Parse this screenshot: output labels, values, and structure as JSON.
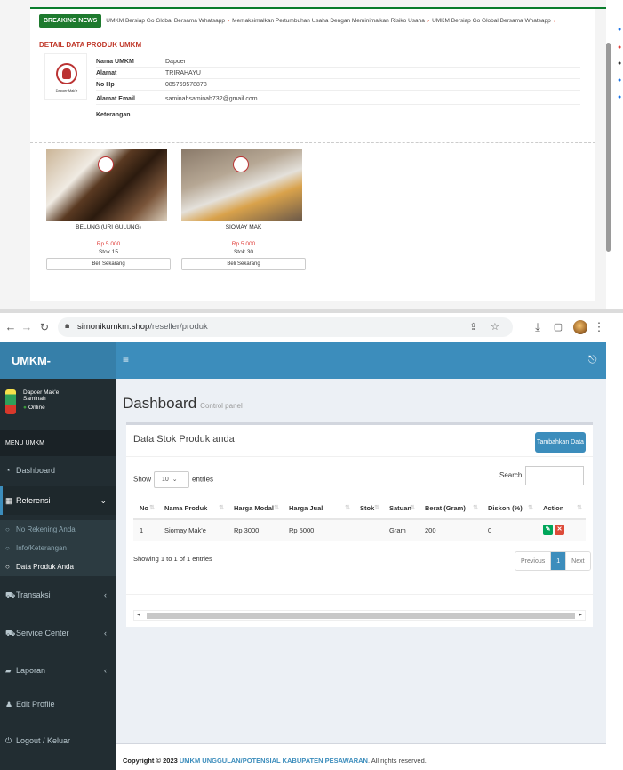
{
  "top_page": {
    "breaking_label": "BREAKING NEWS",
    "ticker": [
      "UMKM Bersiap Go Global Bersama Whatsapp",
      "Memaksimalkan Pertumbuhan Usaha Dengan Meminimalkan Risiko Usaha",
      "UMKM Bersiap Go Global Bersama Whatsapp"
    ],
    "detail_title": "DETAIL DATA PRODUK UMKM",
    "details": [
      {
        "key": "Nama UMKM",
        "value": "Dapoer"
      },
      {
        "key": "Alamat",
        "value": "TRIRAHAYU"
      },
      {
        "key": "No Hp",
        "value": "085769578878"
      },
      {
        "key": "Alamat Email",
        "value": "saminahsaminah732@gmail.com"
      },
      {
        "key": "Keterangan",
        "value": ""
      }
    ],
    "products": [
      {
        "name": "BELUNG (URI GULUNG)",
        "price": "Rp 5.000",
        "stock": "Stok 15",
        "button": "Beli Sekarang"
      },
      {
        "name": "SIOMAY MAK",
        "price": "Rp 5.000",
        "stock": "Stok 30",
        "button": "Beli Sekarang"
      }
    ]
  },
  "browser": {
    "url_host": "simonikumkm.shop",
    "url_path": "/reseller/produk"
  },
  "app": {
    "brand": "UMKM-PESAWARAN",
    "user_name": "Dapoer Mak'e Saminah",
    "user_status": "Online",
    "menu_header": "MENU UMKM",
    "nav": {
      "dashboard": "Dashboard",
      "referensi": "Referensi",
      "no_rekening": "No Rekening Anda",
      "info_keterangan": "Info/Keterangan",
      "data_produk": "Data Produk Anda",
      "transaksi": "Transaksi",
      "service_center": "Service Center",
      "laporan": "Laporan",
      "edit_profile": "Edit Profile",
      "logout": "Logout / Keluar"
    },
    "page_title": "Dashboard",
    "page_subtitle": "Control panel",
    "box_title": "Data Stok Produk anda",
    "add_button": "Tambahkan Data",
    "show_label": "Show",
    "show_value": "10",
    "entries_label": "entries",
    "search_label": "Search:",
    "search_value": "",
    "table": {
      "headers": [
        "No",
        "Nama Produk",
        "Harga Modal",
        "Harga Jual",
        "Stok",
        "Satuan",
        "Berat (Gram)",
        "Diskon (%)",
        "Action"
      ],
      "rows": [
        {
          "no": "1",
          "nama": "Siomay Mak'e",
          "modal": "Rp 3000",
          "jual": "Rp 5000",
          "stok": "",
          "satuan": "Gram",
          "berat": "200",
          "diskon": "0"
        }
      ]
    },
    "info_text": "Showing 1 to 1 of 1 entries",
    "pager": {
      "prev": "Previous",
      "current": "1",
      "next": "Next"
    },
    "footer": {
      "prefix": "Copyright © 2023",
      "link": "UMKM UNGGULAN/POTENSIAL KABUPATEN PESAWARAN",
      "suffix": ". All rights reserved."
    }
  },
  "colors": {
    "header_blue": "#3c8dbc",
    "sidebar_dark": "#222d32",
    "breaking_green": "#1e7a2e",
    "price_red": "#e0413c",
    "edit_green": "#00a65a",
    "delete_red": "#dd4b39"
  }
}
